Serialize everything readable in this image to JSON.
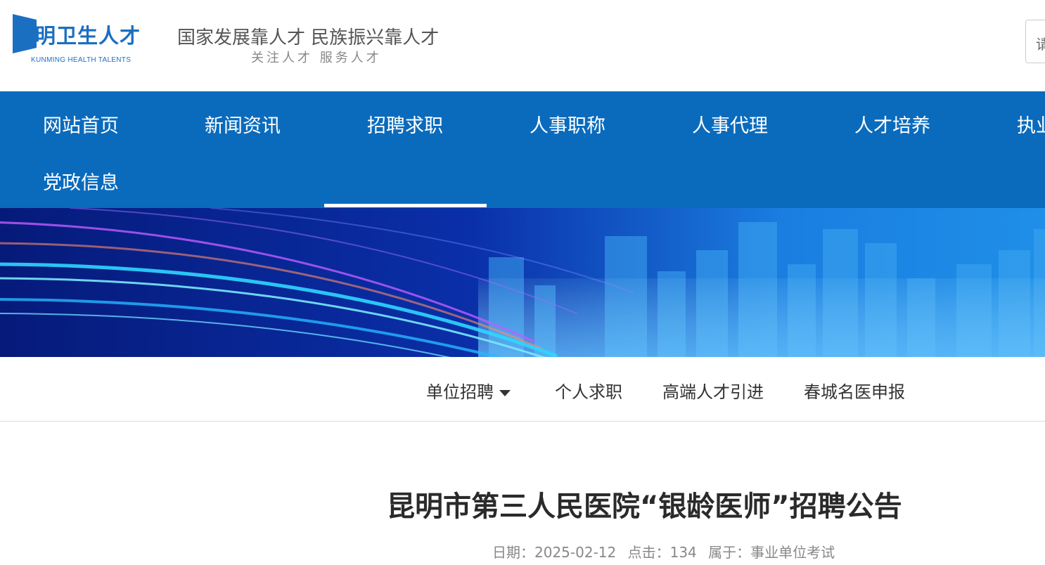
{
  "header": {
    "logo_text": "昆明卫生人才",
    "logo_sub": "KUNMING HEALTH TALENTS",
    "slogan": "国家发展靠人才 民族振兴靠人才",
    "slogan_sub": "关注人才 服务人才",
    "search_placeholder": "请"
  },
  "nav": {
    "items": [
      {
        "label": "网站首页"
      },
      {
        "label": "新闻资讯"
      },
      {
        "label": "招聘求职"
      },
      {
        "label": "人事职称"
      },
      {
        "label": "人事代理"
      },
      {
        "label": "人才培养"
      },
      {
        "label": "执业"
      },
      {
        "label": "党政信息"
      }
    ],
    "active_index": 2
  },
  "subnav": {
    "items": [
      {
        "label": "单位招聘"
      },
      {
        "label": "个人求职"
      },
      {
        "label": "高端人才引进"
      },
      {
        "label": "春城名医申报"
      }
    ]
  },
  "article": {
    "title": "昆明市第三人民医院“银龄医师”招聘公告",
    "date": "日期：2025-02-12",
    "clicks": "点击：134",
    "category": "属于：事业单位考试"
  },
  "colors": {
    "brand_blue": "#0a6bbd",
    "logo_blue": "#1a6fc1"
  }
}
